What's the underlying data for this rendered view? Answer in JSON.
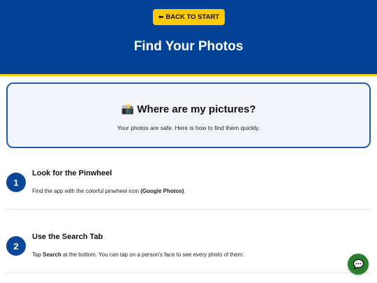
{
  "header": {
    "back_button": "BACK TO START",
    "back_arrow": "⬅",
    "title": "Find Your Photos",
    "colors": {
      "background": "#024397",
      "accent": "#f6ce0c",
      "button": "#fbc905"
    }
  },
  "intro_card": {
    "icon": "📸",
    "title": "Where are my pictures?",
    "subtitle": "Your photos are safe. Here is how to find them quickly."
  },
  "steps": [
    {
      "number": "1",
      "title": "Look for the Pinwheel",
      "text_before": "Find the app with the colorful pinwheel icon ",
      "text_bold": "(Google Photos)",
      "text_after": "."
    },
    {
      "number": "2",
      "title": "Use the Search Tab",
      "text_before": "Tap ",
      "text_bold": "Search",
      "text_after": " at the bottom. You can tap on a person's face to see every photo of them."
    }
  ],
  "chat_button": {
    "icon": "chat-bubble-icon",
    "color": "#2b7d2f"
  }
}
